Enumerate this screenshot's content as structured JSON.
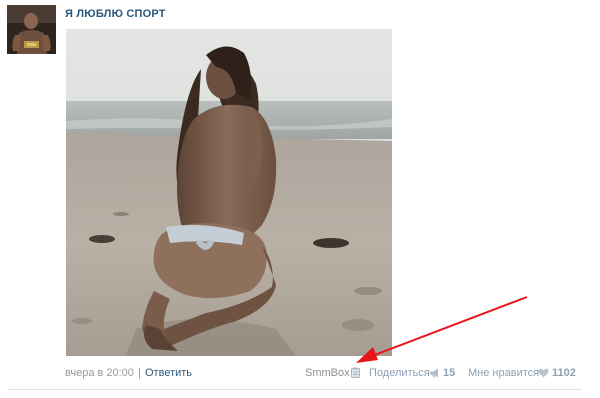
{
  "post": {
    "author": "Я ЛЮБЛЮ СПОРТ",
    "avatar_icon": "community-avatar",
    "photo_icon": "beach-photo"
  },
  "footer": {
    "date": "вчера в 20:00",
    "separator": "|",
    "reply_label": "Ответить",
    "smmbox_label": "SmmBox",
    "smmbox_icon": "clipboard-icon",
    "share_label": "Поделиться",
    "share_icon": "megaphone-icon",
    "share_count": "15",
    "like_label": "Мне нравится",
    "like_icon": "heart-icon",
    "like_count": "1102"
  },
  "colors": {
    "link": "#2b587a",
    "muted": "#999999",
    "action": "#8ea0b3",
    "annotation_arrow": "#e8141c"
  }
}
